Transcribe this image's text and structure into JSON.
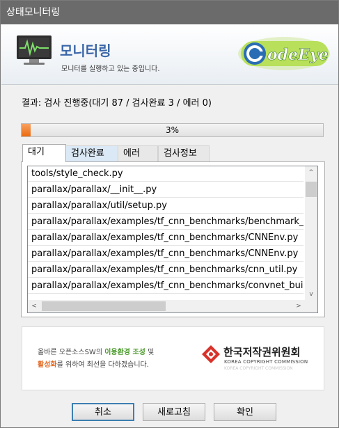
{
  "window": {
    "title": "상태모니터링"
  },
  "banner": {
    "title": "모니터링",
    "subtitle": "모니터를 실행하고 있는 중입니다.",
    "logo_text": "odeEye"
  },
  "status": {
    "result_text": "결과: 검사 진행중(대기 87 / 검사완료 3 / 에러 0)"
  },
  "progress": {
    "percent": 3,
    "label": "3%"
  },
  "tabs": [
    {
      "label": "대기",
      "selected": true
    },
    {
      "label": "검사완료",
      "selected": false
    },
    {
      "label": "에러",
      "selected": false
    },
    {
      "label": "검사정보",
      "selected": false
    }
  ],
  "file_list": [
    "tools/style_check.py",
    "parallax/parallax/__init__.py",
    "parallax/parallax/util/setup.py",
    "parallax/parallax/examples/tf_cnn_benchmarks/benchmark_cnn.py",
    "parallax/parallax/examples/tf_cnn_benchmarks/CNNEnv.py",
    "parallax/parallax/examples/tf_cnn_benchmarks/CNNEnv.py",
    "parallax/parallax/examples/tf_cnn_benchmarks/cnn_util.py",
    "parallax/parallax/examples/tf_cnn_benchmarks/convnet_builder.py"
  ],
  "scroll": {
    "up": "^",
    "down": "v",
    "left": "<",
    "right": ">"
  },
  "ad": {
    "line1_prefix": "올바른 오픈소스SW의 ",
    "line1_highlight": "이용환경 조성",
    "line1_suffix": " 및",
    "line2_highlight": "활성화",
    "line2_suffix": "를 위하여 최선을 다하겠습니다.",
    "org_name": "한국저작권위원회",
    "org_english": "KOREA COPYRIGHT COMMISSION",
    "org_english_faded": "KOREA COPYRIGHT COMMISSION"
  },
  "buttons": {
    "cancel": "취소",
    "refresh": "새로고침",
    "ok": "확인"
  },
  "colors": {
    "title_bar": "#6b6b6b",
    "progress_fill": "#ea6a10",
    "banner_title": "#3a66a8",
    "default_button_border": "#3c7fb1"
  }
}
